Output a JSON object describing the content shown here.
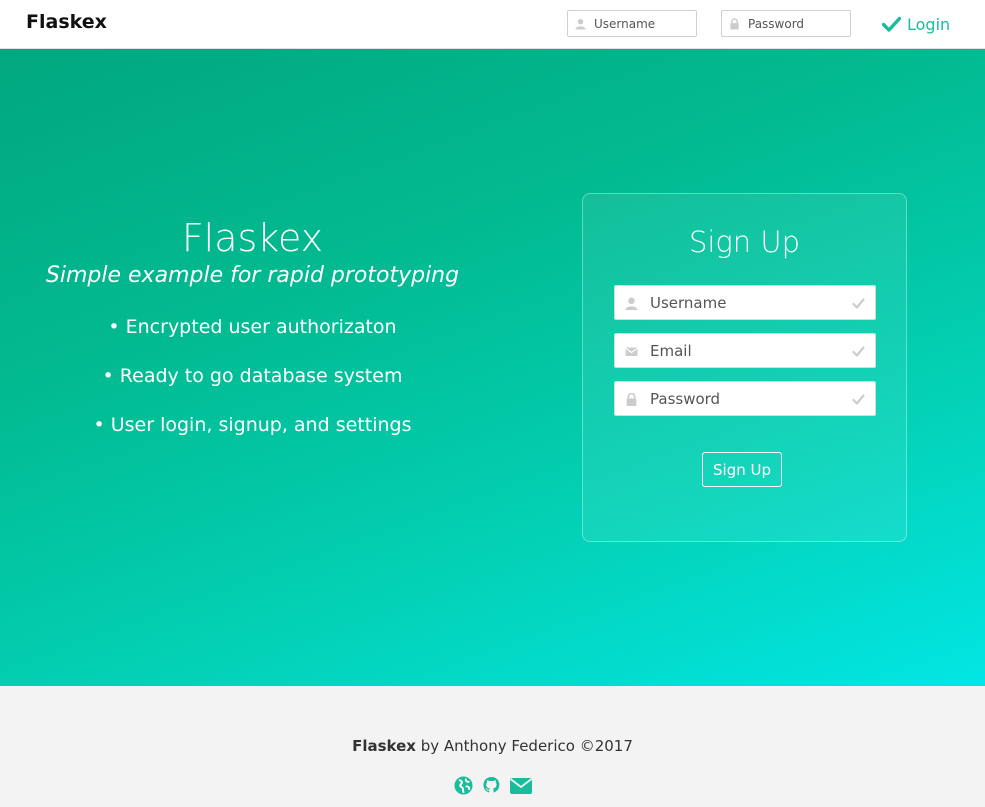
{
  "navbar": {
    "brand": "Flaskex",
    "username_placeholder": "Username",
    "password_placeholder": "Password",
    "login_label": "Login"
  },
  "hero": {
    "title": "Flaskex",
    "subtitle": "Simple example for rapid prototyping",
    "features": [
      "• Encrypted user authorizaton",
      "• Ready to go database system",
      "• User login, signup, and settings"
    ]
  },
  "signup": {
    "title": "Sign Up",
    "username_placeholder": "Username",
    "email_placeholder": "Email",
    "password_placeholder": "Password",
    "button_label": "Sign Up"
  },
  "footer": {
    "brand": "Flaskex",
    "credit": " by Anthony Federico ©2017",
    "icons": [
      "globe-icon",
      "github-icon",
      "envelope-icon"
    ]
  },
  "colors": {
    "accent": "#1bbc9b",
    "hero_start": "#01a77f",
    "hero_end": "#02e6e4",
    "footer_bg": "#f3f3f3"
  }
}
